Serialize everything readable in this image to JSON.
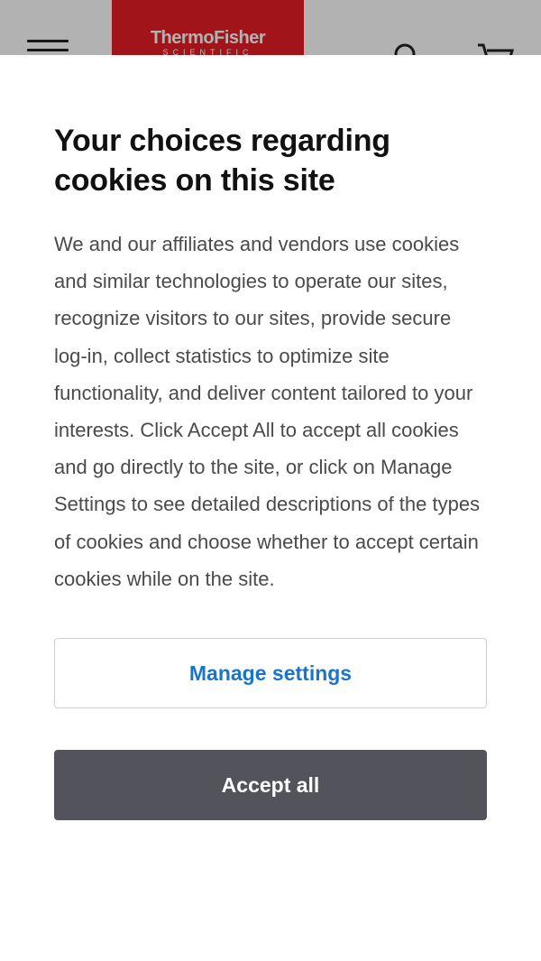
{
  "header": {
    "logo_brand": "ThermoFisher",
    "logo_sub": "SCIENTIFIC"
  },
  "cookie_modal": {
    "title": "Your choices regarding cookies on this site",
    "body": "We and our affiliates and vendors use cookies and similar technologies to operate our sites, recognize visitors to our sites, provide secure log-in, collect statistics to optimize site functionality, and deliver content tailored to your interests. Click Accept All to accept all cookies and go directly to the site, or click on Manage Settings to see detailed descriptions of the types of cookies and choose whether to accept certain cookies while on the site.",
    "manage_label": "Manage settings",
    "accept_label": "Accept all"
  },
  "colors": {
    "brand_red": "#e71f26",
    "link_blue": "#1a74c9",
    "accept_button": "#53535c"
  },
  "icons": [
    "menu-icon",
    "search-icon",
    "cart-icon"
  ]
}
